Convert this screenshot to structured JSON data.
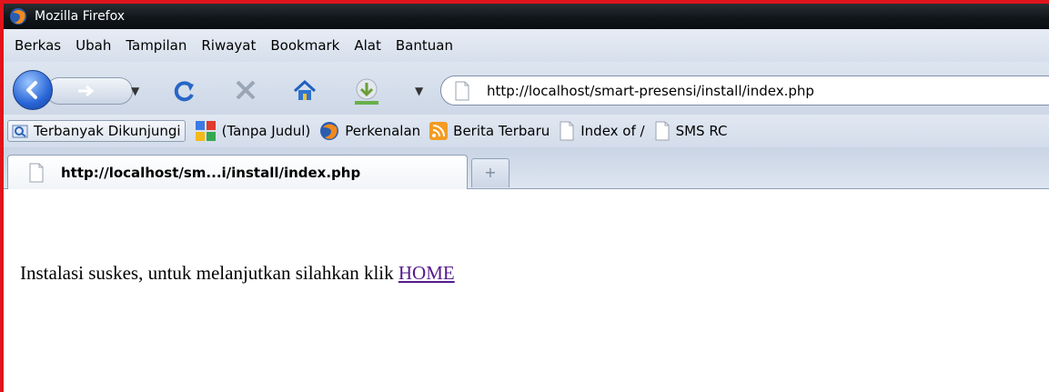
{
  "window": {
    "title": "Mozilla Firefox"
  },
  "menubar": {
    "items": [
      "Berkas",
      "Ubah",
      "Tampilan",
      "Riwayat",
      "Bookmark",
      "Alat",
      "Bantuan"
    ]
  },
  "navbar": {
    "url": "http://localhost/smart-presensi/install/index.php"
  },
  "bookmarks": {
    "items": [
      {
        "label": "Terbanyak Dikunjungi",
        "icon": "magnifier-folder-icon"
      },
      {
        "label": "(Tanpa Judul)",
        "icon": "google-icon"
      },
      {
        "label": "Perkenalan",
        "icon": "firefox-icon"
      },
      {
        "label": "Berita Terbaru",
        "icon": "rss-icon"
      },
      {
        "label": "Index of /",
        "icon": "page-icon"
      },
      {
        "label": "SMS RC",
        "icon": "page-icon"
      }
    ]
  },
  "tabs": {
    "active_label": "http://localhost/sm...i/install/index.php",
    "new_tab_symbol": "+"
  },
  "content": {
    "message": "Instalasi suskes, untuk melanjutkan silahkan klik ",
    "link_label": "HOME"
  },
  "colors": {
    "frame_border": "#e0141b",
    "titlebar": "#11161b",
    "chrome": "#d6dfec",
    "visited_link": "#551a8b"
  }
}
